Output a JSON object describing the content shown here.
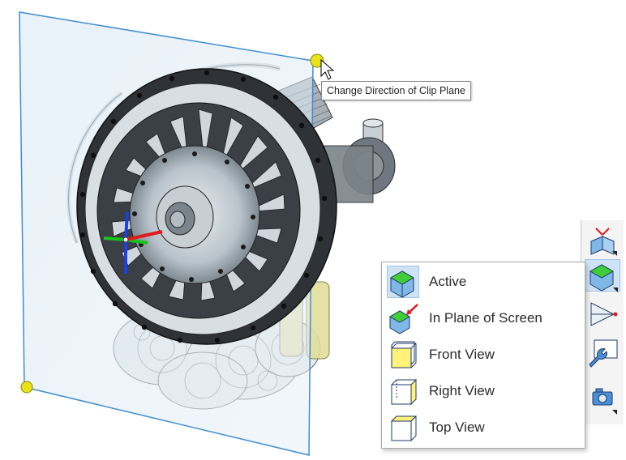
{
  "tooltip": {
    "text": "Change Direction of Clip Plane"
  },
  "menu": {
    "items": [
      {
        "label": "Active",
        "icon": "clip-active-icon",
        "selected": true
      },
      {
        "label": "In Plane of Screen",
        "icon": "clip-plane-of-screen-icon",
        "selected": false
      },
      {
        "label": "Front View",
        "icon": "clip-front-view-icon",
        "selected": false
      },
      {
        "label": "Right View",
        "icon": "clip-right-view-icon",
        "selected": false
      },
      {
        "label": "Top View",
        "icon": "clip-top-view-icon",
        "selected": false
      }
    ]
  },
  "toolbar": {
    "buttons": [
      {
        "icon": "clip-plane-position-icon"
      },
      {
        "icon": "clip-active-icon"
      },
      {
        "icon": "section-view-icon"
      },
      {
        "icon": "clip-settings-wrench-icon"
      },
      {
        "icon": "camera-icon"
      }
    ]
  },
  "colors": {
    "clip_plane_fill": "#cfe2f1",
    "clip_plane_edge": "#3f8ed0",
    "handle_yellow": "#e8e21a",
    "axis_red": "#e01b1b",
    "axis_green": "#17c21a",
    "axis_blue": "#1f3fe0",
    "icon_green": "#3fce3a",
    "icon_yellow": "#fff27a",
    "icon_outline": "#1f3a66",
    "selection_blue": "#cfe3f6"
  }
}
